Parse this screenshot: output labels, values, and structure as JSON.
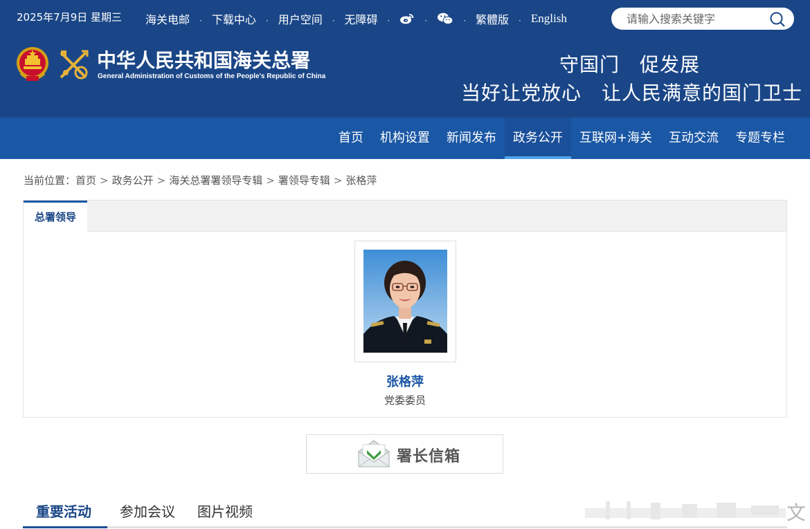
{
  "topbar": {
    "date": "2025年7月9日 星期三",
    "links": [
      {
        "label": "海关电邮"
      },
      {
        "label": "下载中心"
      },
      {
        "label": "用户空间"
      },
      {
        "label": "无障碍"
      },
      {
        "icon": "weibo-icon"
      },
      {
        "icon": "wechat-icon"
      },
      {
        "label": "繁體版"
      },
      {
        "label": "English"
      }
    ],
    "search_placeholder": "请输入搜索关键字"
  },
  "brand": {
    "name_cn": "中华人民共和国海关总署",
    "name_en": "General Administration of Customs of the People's Republic of China"
  },
  "slogan": {
    "line1": "守国门　促发展",
    "line2": "当好让党放心　让人民满意的国门卫士"
  },
  "nav": {
    "items": [
      "首页",
      "机构设置",
      "新闻发布",
      "政务公开",
      "互联网+海关",
      "互动交流",
      "专题专栏"
    ],
    "active": "政务公开"
  },
  "breadcrumb": {
    "prefix": "当前位置：",
    "items": [
      "首页",
      "政务公开",
      "海关总署署领导专辑",
      "署领导专辑",
      "张格萍"
    ],
    "separator": ">"
  },
  "panel": {
    "tab_label": "总署领导",
    "leader_name": "张格萍",
    "leader_title": "党委委员"
  },
  "mailbox": {
    "label": "署长信箱"
  },
  "bottom_tabs": {
    "items": [
      "重要活动",
      "参加会议",
      "图片视频"
    ],
    "active": "重要活动"
  },
  "watermark_char": "文",
  "colors": {
    "header_bg": "#1a4687",
    "nav_bg": "#1a57a5",
    "nav_active_underline": "#4ea3e8",
    "accent_text": "#1a57a5"
  }
}
